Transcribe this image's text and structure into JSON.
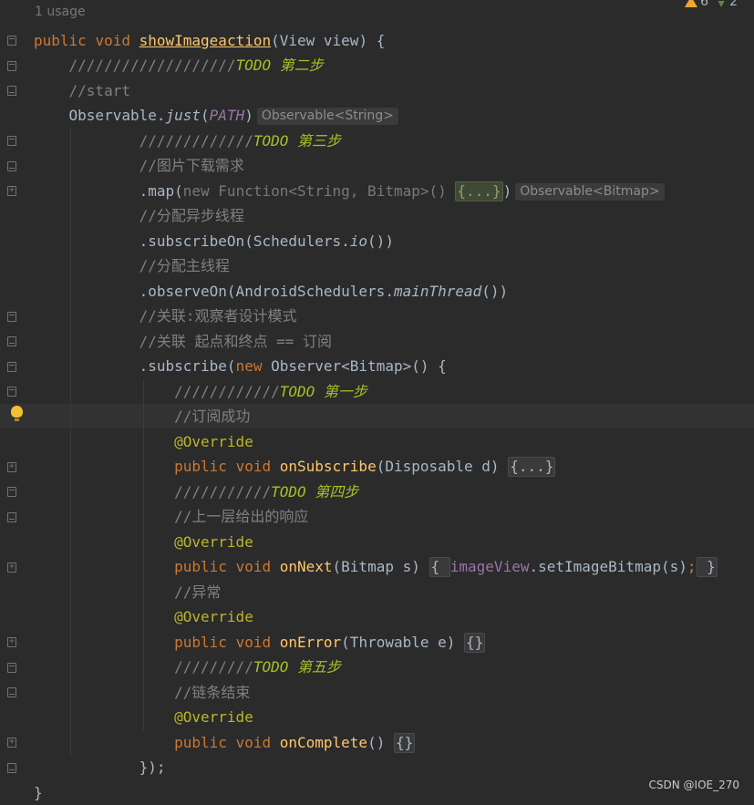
{
  "editor": {
    "usage_hint": "1 usage",
    "inspections": {
      "warnings": "6",
      "weak_warnings": "2"
    },
    "watermark": "CSDN @IOE_270",
    "lines": [
      {
        "parts": [
          {
            "c": "kw",
            "t": "public "
          },
          {
            "c": "kw",
            "t": "void "
          },
          {
            "c": "fn-u",
            "t": "showImageaction"
          },
          {
            "c": "",
            "t": "(View view) {"
          }
        ]
      },
      {
        "parts": [
          {
            "c": "",
            "t": "    "
          },
          {
            "c": "cm",
            "t": "///////////////////"
          },
          {
            "c": "todo",
            "t": "TODO 第二步"
          }
        ]
      },
      {
        "parts": [
          {
            "c": "",
            "t": "    "
          },
          {
            "c": "cm",
            "t": "//start"
          }
        ]
      },
      {
        "parts": [
          {
            "c": "",
            "t": "    Observable."
          },
          {
            "c": "static",
            "t": "just"
          },
          {
            "c": "",
            "t": "("
          },
          {
            "c": "const",
            "t": "PATH"
          },
          {
            "c": "",
            "t": ")"
          },
          {
            "c": "hint",
            "t": "Observable<String>"
          }
        ]
      },
      {
        "parts": [
          {
            "c": "",
            "t": "            "
          },
          {
            "c": "cm",
            "t": "/////////////"
          },
          {
            "c": "todo",
            "t": "TODO 第三步"
          }
        ]
      },
      {
        "parts": [
          {
            "c": "",
            "t": "            "
          },
          {
            "c": "cm",
            "t": "//图片下载需求"
          }
        ]
      },
      {
        "parts": [
          {
            "c": "",
            "t": "            .map("
          },
          {
            "c": "dim",
            "t": "new Function<String, Bitmap>() "
          },
          {
            "c": "fold-hl",
            "t": "{...}"
          },
          {
            "c": "",
            "t": ")"
          },
          {
            "c": "hint",
            "t": "Observable<Bitmap>"
          }
        ]
      },
      {
        "parts": [
          {
            "c": "",
            "t": "            "
          },
          {
            "c": "cm",
            "t": "//分配异步线程"
          }
        ]
      },
      {
        "parts": [
          {
            "c": "",
            "t": "            .subscribeOn(Schedulers."
          },
          {
            "c": "static",
            "t": "io"
          },
          {
            "c": "",
            "t": "())"
          }
        ]
      },
      {
        "parts": [
          {
            "c": "",
            "t": "            "
          },
          {
            "c": "cm",
            "t": "//分配主线程"
          }
        ]
      },
      {
        "parts": [
          {
            "c": "",
            "t": "            .observeOn(AndroidSchedulers."
          },
          {
            "c": "static",
            "t": "mainThread"
          },
          {
            "c": "",
            "t": "())"
          }
        ]
      },
      {
        "parts": [
          {
            "c": "",
            "t": "            "
          },
          {
            "c": "cm",
            "t": "//关联:观察者设计模式"
          }
        ]
      },
      {
        "parts": [
          {
            "c": "",
            "t": "            "
          },
          {
            "c": "cm",
            "t": "//关联 起点和终点 == 订阅"
          }
        ]
      },
      {
        "parts": [
          {
            "c": "",
            "t": "            .subscribe("
          },
          {
            "c": "kw",
            "t": "new "
          },
          {
            "c": "",
            "t": "Observer<Bitmap>() {"
          }
        ]
      },
      {
        "parts": [
          {
            "c": "",
            "t": "                "
          },
          {
            "c": "cm",
            "t": "////////////"
          },
          {
            "c": "todo",
            "t": "TODO 第一步"
          }
        ]
      },
      {
        "parts": [
          {
            "c": "",
            "t": "                "
          },
          {
            "c": "cm",
            "t": "//订阅成功"
          }
        ]
      },
      {
        "parts": [
          {
            "c": "",
            "t": "                "
          },
          {
            "c": "ann",
            "t": "@Override"
          }
        ]
      },
      {
        "parts": [
          {
            "c": "",
            "t": "                "
          },
          {
            "c": "kw",
            "t": "public "
          },
          {
            "c": "kw",
            "t": "void "
          },
          {
            "c": "fn",
            "t": "onSubscribe"
          },
          {
            "c": "",
            "t": "(Disposable d) "
          },
          {
            "c": "fold",
            "t": "{...}"
          }
        ]
      },
      {
        "parts": [
          {
            "c": "",
            "t": "                "
          },
          {
            "c": "cm",
            "t": "///////////"
          },
          {
            "c": "todo",
            "t": "TODO 第四步"
          }
        ]
      },
      {
        "parts": [
          {
            "c": "",
            "t": "                "
          },
          {
            "c": "cm",
            "t": "//上一层给出的响应"
          }
        ]
      },
      {
        "parts": [
          {
            "c": "",
            "t": "                "
          },
          {
            "c": "ann",
            "t": "@Override"
          }
        ]
      },
      {
        "parts": [
          {
            "c": "",
            "t": "                "
          },
          {
            "c": "kw",
            "t": "public "
          },
          {
            "c": "kw",
            "t": "void "
          },
          {
            "c": "fn",
            "t": "onNext"
          },
          {
            "c": "",
            "t": "(Bitmap s) "
          },
          {
            "c": "fold",
            "t": "{ "
          },
          {
            "c": "field",
            "t": "imageView"
          },
          {
            "c": "",
            "t": ".setImageBitmap(s)"
          },
          {
            "c": "kw",
            "t": ";"
          },
          {
            "c": "fold",
            "t": " }"
          }
        ]
      },
      {
        "parts": [
          {
            "c": "",
            "t": "                "
          },
          {
            "c": "cm",
            "t": "//异常"
          }
        ]
      },
      {
        "parts": [
          {
            "c": "",
            "t": "                "
          },
          {
            "c": "ann",
            "t": "@Override"
          }
        ]
      },
      {
        "parts": [
          {
            "c": "",
            "t": "                "
          },
          {
            "c": "kw",
            "t": "public "
          },
          {
            "c": "kw",
            "t": "void "
          },
          {
            "c": "fn",
            "t": "onError"
          },
          {
            "c": "",
            "t": "(Throwable e) "
          },
          {
            "c": "fold",
            "t": "{}"
          }
        ]
      },
      {
        "parts": [
          {
            "c": "",
            "t": "                "
          },
          {
            "c": "cm",
            "t": "/////////"
          },
          {
            "c": "todo",
            "t": "TODO 第五步"
          }
        ]
      },
      {
        "parts": [
          {
            "c": "",
            "t": "                "
          },
          {
            "c": "cm",
            "t": "//链条结束"
          }
        ]
      },
      {
        "parts": [
          {
            "c": "",
            "t": "                "
          },
          {
            "c": "ann",
            "t": "@Override"
          }
        ]
      },
      {
        "parts": [
          {
            "c": "",
            "t": "                "
          },
          {
            "c": "kw",
            "t": "public "
          },
          {
            "c": "kw",
            "t": "void "
          },
          {
            "c": "fn",
            "t": "onComplete"
          },
          {
            "c": "",
            "t": "() "
          },
          {
            "c": "fold",
            "t": "{}"
          }
        ]
      },
      {
        "parts": [
          {
            "c": "",
            "t": "            });"
          }
        ]
      },
      {
        "parts": [
          {
            "c": "",
            "t": "}"
          }
        ]
      }
    ]
  }
}
